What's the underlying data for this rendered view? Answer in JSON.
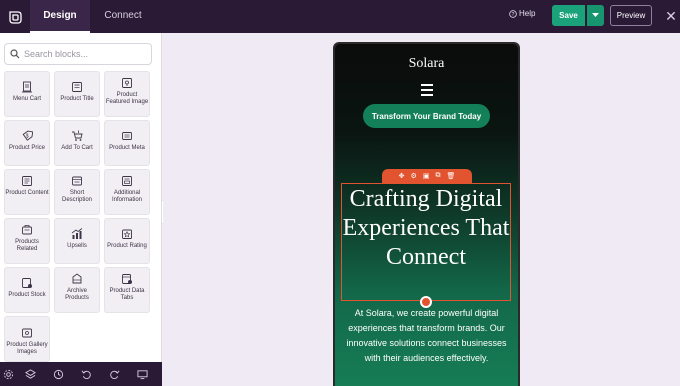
{
  "topbar": {
    "tabs": [
      {
        "label": "Design",
        "active": true
      },
      {
        "label": "Connect",
        "active": false
      }
    ],
    "help_label": "Help",
    "save_label": "Save",
    "preview_label": "Preview",
    "close_icon": "close-icon"
  },
  "sidebar": {
    "search_placeholder": "Search blocks...",
    "blocks": [
      {
        "label": "Menu Cart",
        "icon": "menu-cart-icon"
      },
      {
        "label": "Product Title",
        "icon": "product-title-icon"
      },
      {
        "label": "Product Featured Image",
        "icon": "featured-image-icon"
      },
      {
        "label": "Product Price",
        "icon": "price-icon"
      },
      {
        "label": "Add To Cart",
        "icon": "cart-icon"
      },
      {
        "label": "Product Meta",
        "icon": "meta-icon"
      },
      {
        "label": "Product Content",
        "icon": "content-icon"
      },
      {
        "label": "Short Description",
        "icon": "short-description-icon"
      },
      {
        "label": "Additional Information",
        "icon": "info-icon"
      },
      {
        "label": "Products Related",
        "icon": "related-icon"
      },
      {
        "label": "Upsells",
        "icon": "upsells-icon"
      },
      {
        "label": "Product Rating",
        "icon": "rating-icon"
      },
      {
        "label": "Product Stock",
        "icon": "stock-icon"
      },
      {
        "label": "Archive Products",
        "icon": "archive-icon"
      },
      {
        "label": "Product Data Tabs",
        "icon": "data-tabs-icon"
      },
      {
        "label": "Product Gallery Images",
        "icon": "gallery-icon"
      }
    ]
  },
  "bottombar": {
    "icons": [
      "settings-icon",
      "layers-icon",
      "history-icon",
      "undo-icon",
      "redo-icon",
      "desktop-icon"
    ]
  },
  "preview": {
    "brand": "Solara",
    "cta_label": "Transform Your Brand Today",
    "heading": "Crafting Digital Experiences That Connect",
    "paragraph": "At Solara, we create powerful digital experiences that transform brands. Our innovative solutions connect businesses with their audiences effectively."
  },
  "colors": {
    "topbar_bg": "#2b1a36",
    "accent_green": "#1aa37a",
    "selection_orange": "#e2532f"
  }
}
